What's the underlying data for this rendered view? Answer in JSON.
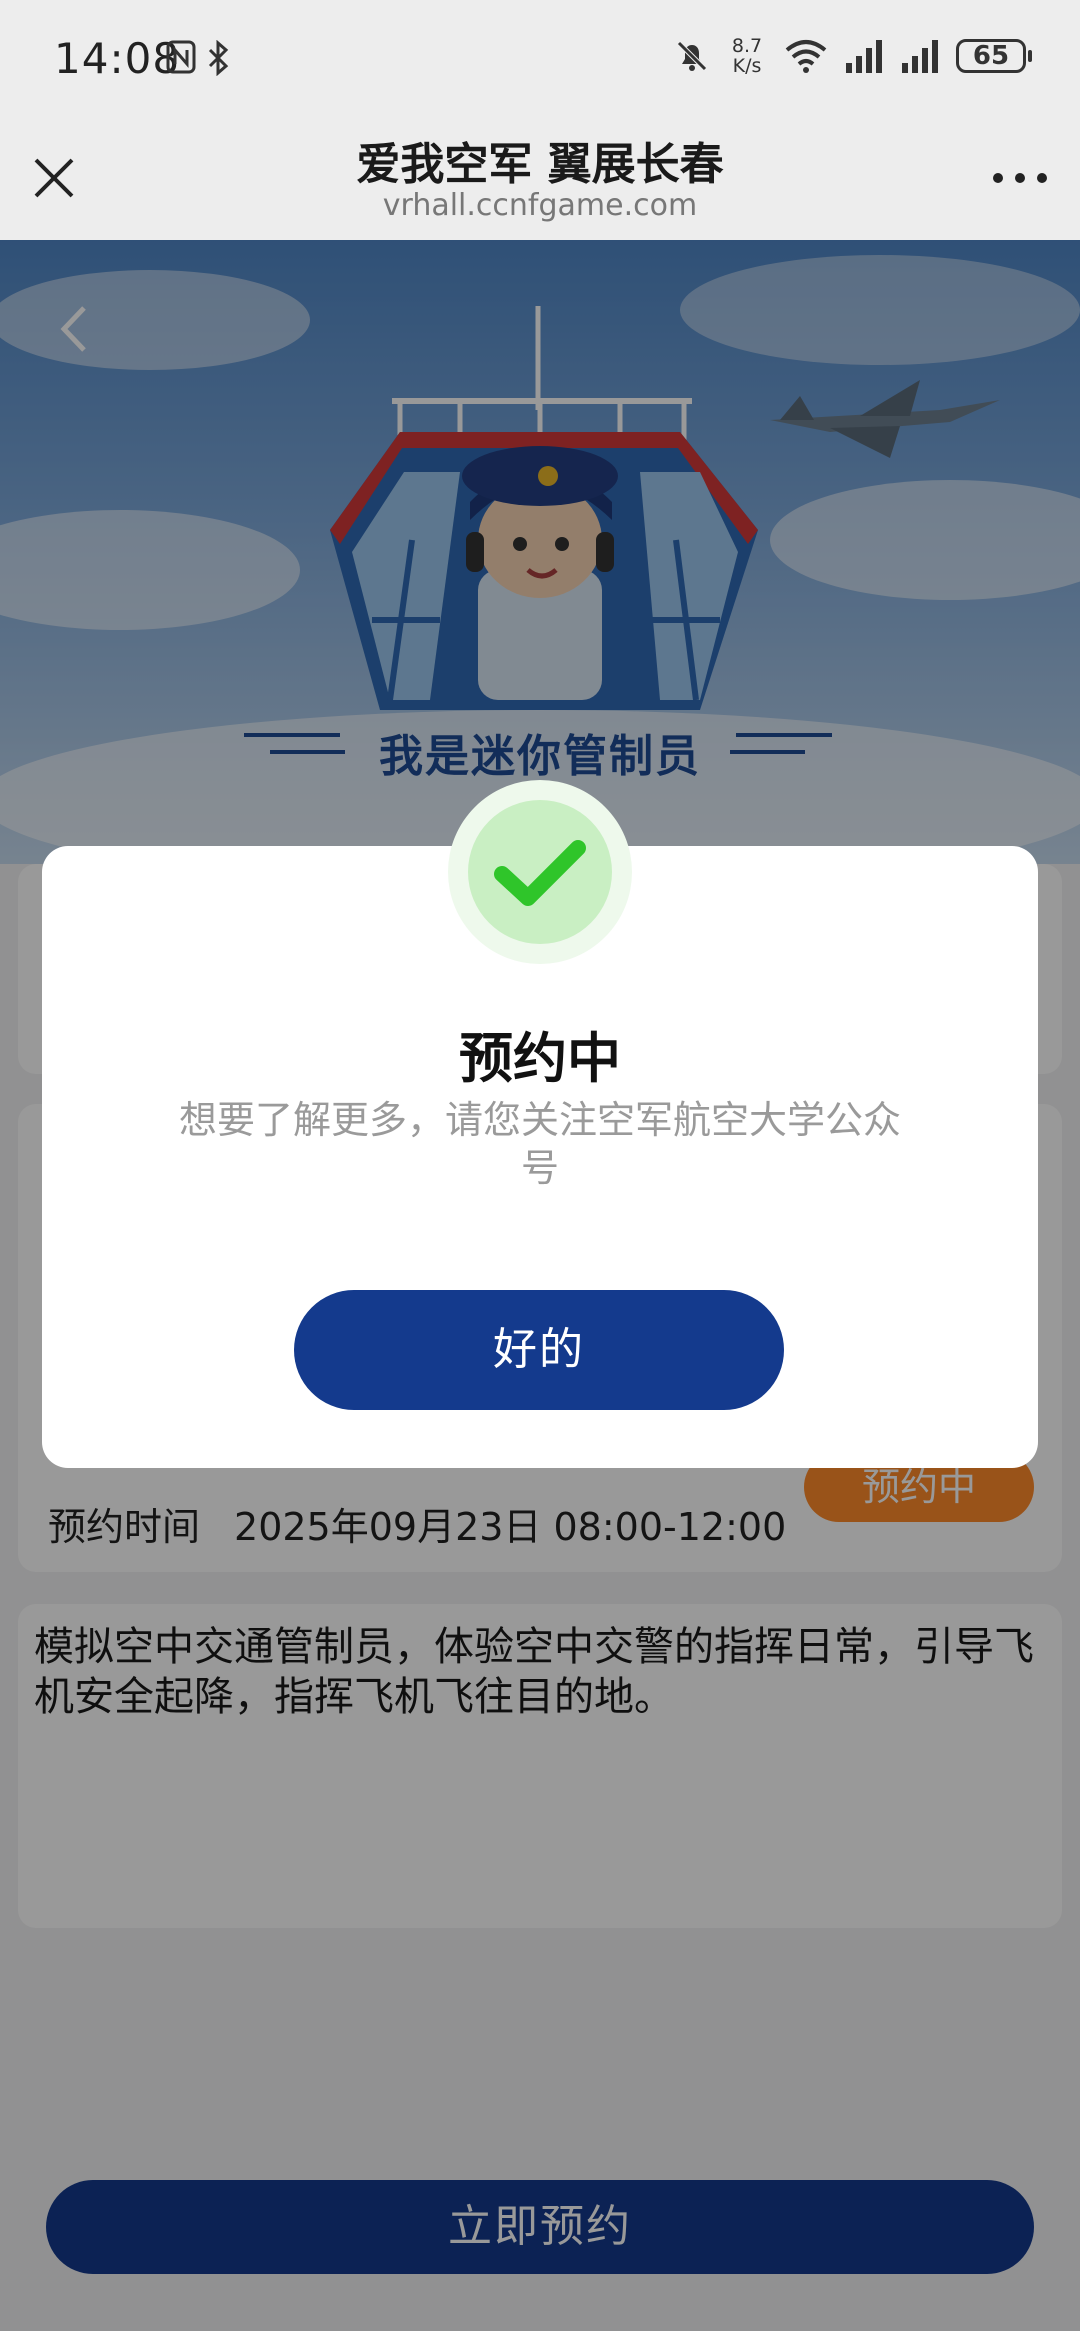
{
  "status_bar": {
    "time": "14:08",
    "net_speed_value": "8.7",
    "net_speed_unit": "K/s",
    "battery": "65"
  },
  "nav": {
    "title": "爱我空军 翼展长春",
    "url": "vrhall.ccnfgame.com"
  },
  "banner": {
    "caption": "我是迷你管制员"
  },
  "booking": {
    "time_label": "预约时间",
    "time_value": "2025年09月23日 08:00-12:00",
    "status_badge": "预约中"
  },
  "description": "模拟空中交通管制员，体验空中交警的指挥日常，引导飞机安全起降，指挥飞机飞往目的地。",
  "bottom_action": {
    "label": "立即预约"
  },
  "modal": {
    "title": "预约中",
    "message": "想要了解更多，请您关注空军航空大学公众号",
    "ok_label": "好的"
  },
  "colors": {
    "primary": "#143a8d",
    "badge_orange": "#ff8a2a",
    "check_green": "#2fc52a"
  }
}
